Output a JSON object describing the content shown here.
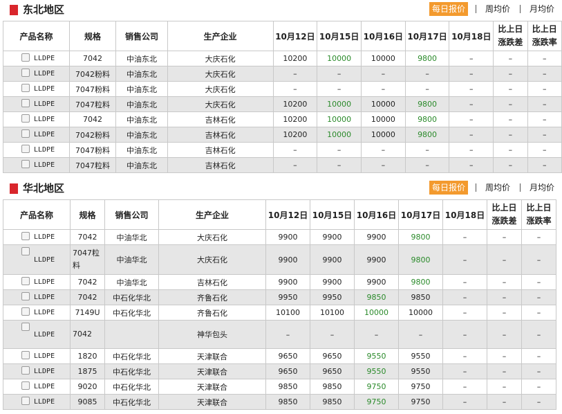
{
  "tabs": {
    "daily": "每日报价",
    "weekly": "周均价",
    "monthly": "月均价"
  },
  "columns": [
    "产品名称",
    "规格",
    "销售公司",
    "生产企业",
    "10月12日",
    "10月15日",
    "10月16日",
    "10月17日",
    "10月18日",
    "比上日涨跌差",
    "比上日涨跌率"
  ],
  "col_head": {
    "c9a": "比上日",
    "c9b": "涨跌差",
    "c10a": "比上日",
    "c10b": "涨跌率"
  },
  "colors": {
    "accent": "#f39a2e",
    "region_mark": "#d9262c",
    "up_value": "#2a8a2a",
    "row_alt": "#e6e6e6"
  },
  "northeast": {
    "title": "东北地区",
    "rows": [
      {
        "product": "LLDPE",
        "spec": "7042",
        "seller": "中油东北",
        "producer": "大庆石化",
        "d12": "10200",
        "d15": "10000",
        "d16": "10000",
        "d17": "9800",
        "d18": "–",
        "diff": "–",
        "rate": "–"
      },
      {
        "product": "LLDPE",
        "spec": "7042粉料",
        "seller": "中油东北",
        "producer": "大庆石化",
        "d12": "–",
        "d15": "–",
        "d16": "–",
        "d17": "–",
        "d18": "–",
        "diff": "–",
        "rate": "–"
      },
      {
        "product": "LLDPE",
        "spec": "7047粉料",
        "seller": "中油东北",
        "producer": "大庆石化",
        "d12": "–",
        "d15": "–",
        "d16": "–",
        "d17": "–",
        "d18": "–",
        "diff": "–",
        "rate": "–"
      },
      {
        "product": "LLDPE",
        "spec": "7047粒料",
        "seller": "中油东北",
        "producer": "大庆石化",
        "d12": "10200",
        "d15": "10000",
        "d16": "10000",
        "d17": "9800",
        "d18": "–",
        "diff": "–",
        "rate": "–"
      },
      {
        "product": "LLDPE",
        "spec": "7042",
        "seller": "中油东北",
        "producer": "吉林石化",
        "d12": "10200",
        "d15": "10000",
        "d16": "10000",
        "d17": "9800",
        "d18": "–",
        "diff": "–",
        "rate": "–"
      },
      {
        "product": "LLDPE",
        "spec": "7042粉料",
        "seller": "中油东北",
        "producer": "吉林石化",
        "d12": "10200",
        "d15": "10000",
        "d16": "10000",
        "d17": "9800",
        "d18": "–",
        "diff": "–",
        "rate": "–"
      },
      {
        "product": "LLDPE",
        "spec": "7047粉料",
        "seller": "中油东北",
        "producer": "吉林石化",
        "d12": "–",
        "d15": "–",
        "d16": "–",
        "d17": "–",
        "d18": "–",
        "diff": "–",
        "rate": "–"
      },
      {
        "product": "LLDPE",
        "spec": "7047粒料",
        "seller": "中油东北",
        "producer": "吉林石化",
        "d12": "–",
        "d15": "–",
        "d16": "–",
        "d17": "–",
        "d18": "–",
        "diff": "–",
        "rate": "–"
      }
    ]
  },
  "north": {
    "title": "华北地区",
    "rows": [
      {
        "product": "LLDPE",
        "spec": "7042",
        "seller": "中油华北",
        "producer": "大庆石化",
        "d12": "9900",
        "d15": "9900",
        "d16": "9900",
        "d17": "9800",
        "d18": "–",
        "diff": "–",
        "rate": "–"
      },
      {
        "product": "LLDPE",
        "spec": "7047粒料",
        "seller": "中油华北",
        "producer": "大庆石化",
        "d12": "9900",
        "d15": "9900",
        "d16": "9900",
        "d17": "9800",
        "d18": "–",
        "diff": "–",
        "rate": "–"
      },
      {
        "product": "LLDPE",
        "spec": "7042",
        "seller": "中油华北",
        "producer": "吉林石化",
        "d12": "9900",
        "d15": "9900",
        "d16": "9900",
        "d17": "9800",
        "d18": "–",
        "diff": "–",
        "rate": "–"
      },
      {
        "product": "LLDPE",
        "spec": "7042",
        "seller": "中石化华北",
        "producer": "齐鲁石化",
        "d12": "9950",
        "d15": "9950",
        "d16": "9850",
        "d17": "9850",
        "d18": "–",
        "diff": "–",
        "rate": "–"
      },
      {
        "product": "LLDPE",
        "spec": "7149U",
        "seller": "中石化华北",
        "producer": "齐鲁石化",
        "d12": "10100",
        "d15": "10100",
        "d16": "10000",
        "d17": "10000",
        "d18": "–",
        "diff": "–",
        "rate": "–"
      },
      {
        "product": "LLDPE",
        "spec": "7042",
        "seller": "",
        "producer": "神华包头",
        "d12": "–",
        "d15": "–",
        "d16": "–",
        "d17": "–",
        "d18": "–",
        "diff": "–",
        "rate": "–"
      },
      {
        "product": "LLDPE",
        "spec": "1820",
        "seller": "中石化华北",
        "producer": "天津联合",
        "d12": "9650",
        "d15": "9650",
        "d16": "9550",
        "d17": "9550",
        "d18": "–",
        "diff": "–",
        "rate": "–"
      },
      {
        "product": "LLDPE",
        "spec": "1875",
        "seller": "中石化华北",
        "producer": "天津联合",
        "d12": "9650",
        "d15": "9650",
        "d16": "9550",
        "d17": "9550",
        "d18": "–",
        "diff": "–",
        "rate": "–"
      },
      {
        "product": "LLDPE",
        "spec": "9020",
        "seller": "中石化华北",
        "producer": "天津联合",
        "d12": "9850",
        "d15": "9850",
        "d16": "9750",
        "d17": "9750",
        "d18": "–",
        "diff": "–",
        "rate": "–"
      },
      {
        "product": "LLDPE",
        "spec": "9085",
        "seller": "中石化华北",
        "producer": "天津联合",
        "d12": "9850",
        "d15": "9850",
        "d16": "9750",
        "d17": "9750",
        "d18": "–",
        "diff": "–",
        "rate": "–"
      }
    ]
  }
}
